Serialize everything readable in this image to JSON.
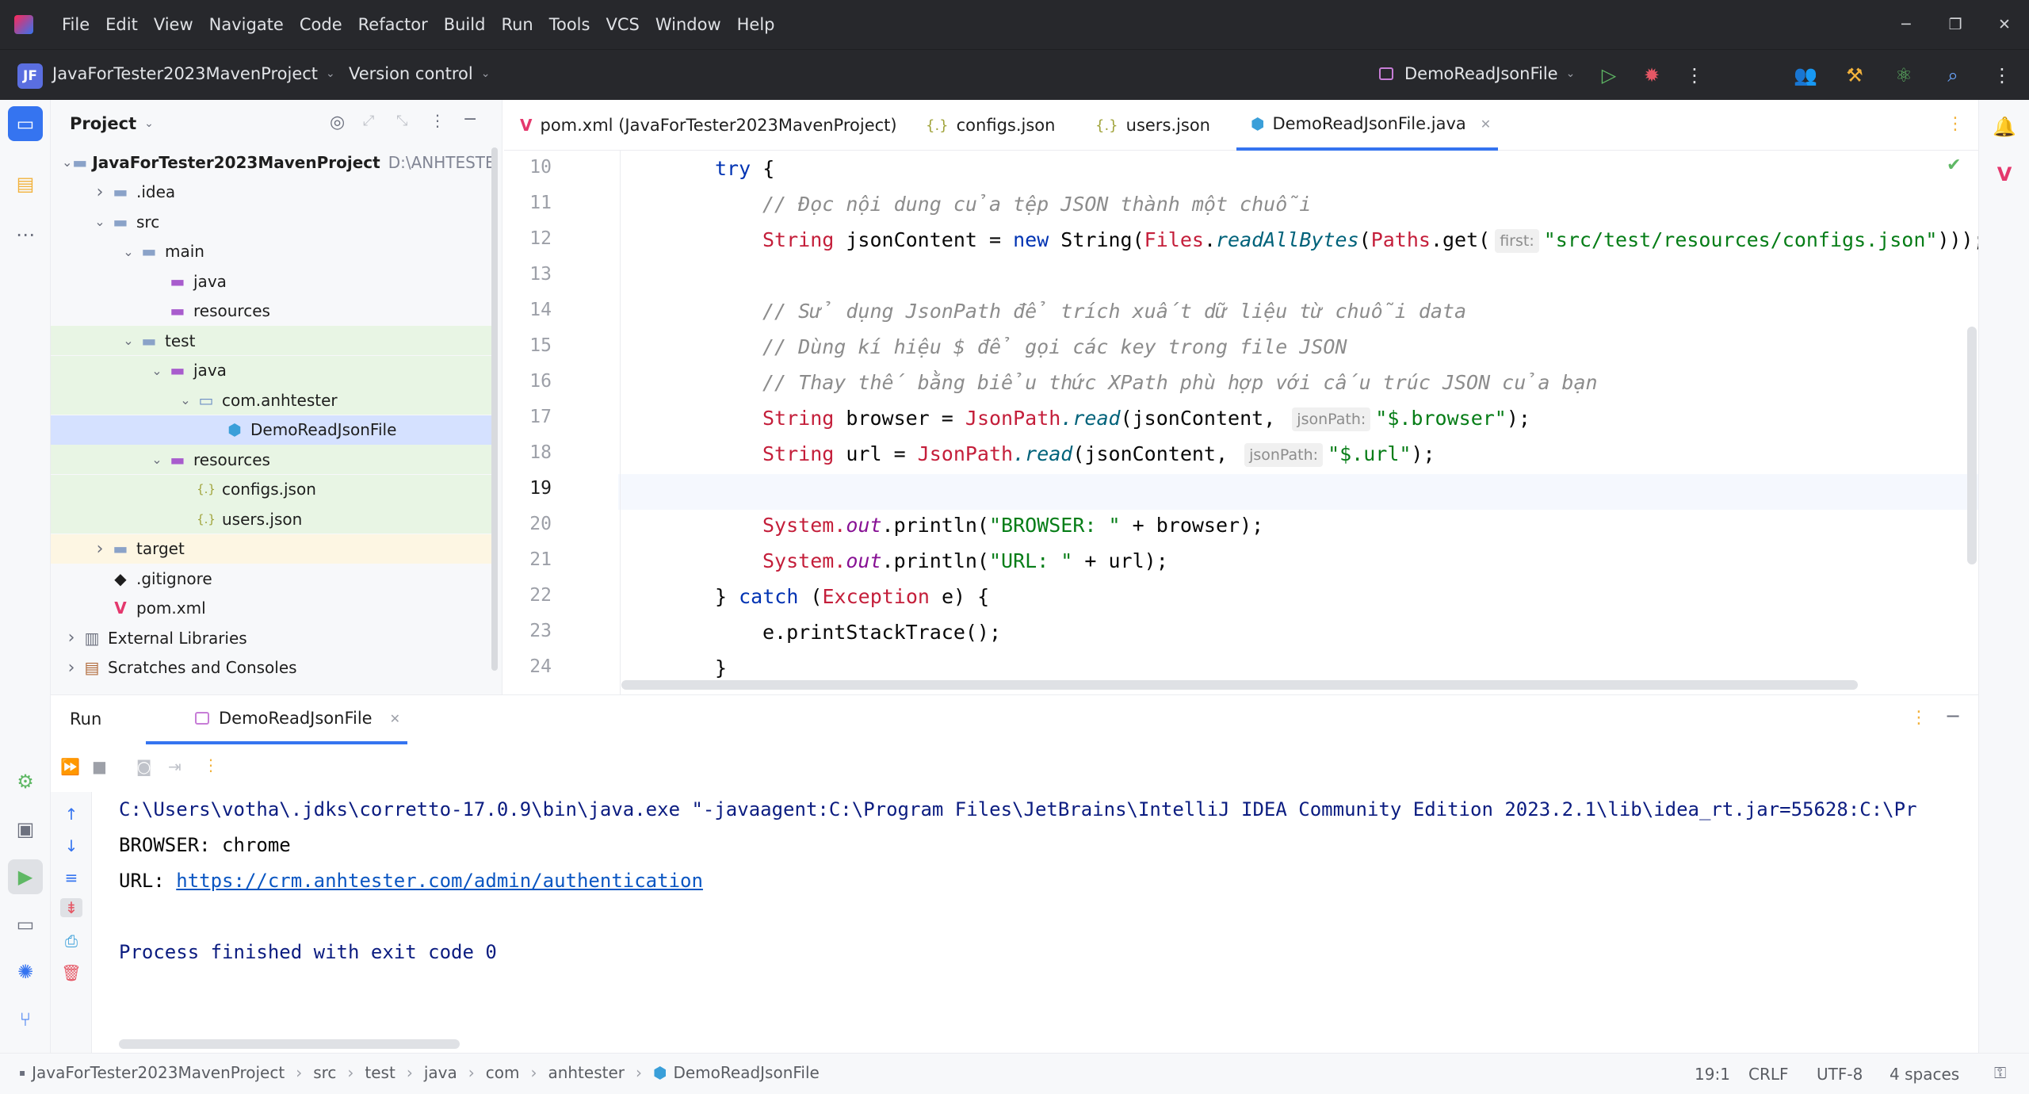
{
  "menu": [
    "File",
    "Edit",
    "View",
    "Navigate",
    "Code",
    "Refactor",
    "Build",
    "Run",
    "Tools",
    "VCS",
    "Window",
    "Help"
  ],
  "toolbar": {
    "project_badge": "JF",
    "project_name": "JavaForTester2023MavenProject",
    "version_control": "Version control",
    "run_config": "DemoReadJsonFile"
  },
  "project_panel": {
    "title": "Project",
    "tree": [
      {
        "label": "JavaForTester2023MavenProject",
        "hint": "D:\\ANHTESTER",
        "depth": 0,
        "expanded": true,
        "icon": "folder-icon",
        "bold": true
      },
      {
        "label": ".idea",
        "depth": 1,
        "expanded": false,
        "icon": "folder-icon"
      },
      {
        "label": "src",
        "depth": 1,
        "expanded": true,
        "icon": "folder-icon"
      },
      {
        "label": "main",
        "depth": 2,
        "expanded": true,
        "icon": "folder-icon"
      },
      {
        "label": "java",
        "depth": 3,
        "icon": "source-folder-icon"
      },
      {
        "label": "resources",
        "depth": 3,
        "icon": "resources-folder-icon"
      },
      {
        "label": "test",
        "depth": 2,
        "expanded": true,
        "icon": "folder-icon"
      },
      {
        "label": "java",
        "depth": 3,
        "expanded": true,
        "icon": "test-folder-icon"
      },
      {
        "label": "com.anhtester",
        "depth": 4,
        "expanded": true,
        "icon": "package-icon"
      },
      {
        "label": "DemoReadJsonFile",
        "depth": 5,
        "icon": "java-class-icon",
        "selected": true
      },
      {
        "label": "resources",
        "depth": 3,
        "expanded": true,
        "icon": "resources-folder-icon"
      },
      {
        "label": "configs.json",
        "depth": 4,
        "icon": "json-icon"
      },
      {
        "label": "users.json",
        "depth": 4,
        "icon": "json-icon"
      },
      {
        "label": "target",
        "depth": 1,
        "expanded": false,
        "icon": "folder-icon"
      },
      {
        "label": ".gitignore",
        "depth": 1,
        "icon": "git-icon"
      },
      {
        "label": "pom.xml",
        "depth": 1,
        "icon": "maven-icon"
      },
      {
        "label": "External Libraries",
        "depth": 0,
        "expanded": false,
        "icon": "library-icon"
      },
      {
        "label": "Scratches and Consoles",
        "depth": 0,
        "expanded": false,
        "icon": "scratches-icon"
      }
    ]
  },
  "editor_tabs": [
    {
      "label": "pom.xml (JavaForTester2023MavenProject)",
      "icon": "maven-icon"
    },
    {
      "label": "configs.json",
      "icon": "json-icon"
    },
    {
      "label": "users.json",
      "icon": "json-icon"
    },
    {
      "label": "DemoReadJsonFile.java",
      "icon": "java-class-icon",
      "active": true
    }
  ],
  "editor": {
    "line_numbers": [
      "10",
      "11",
      "12",
      "13",
      "14",
      "15",
      "16",
      "17",
      "18",
      "19",
      "20",
      "21",
      "22",
      "23",
      "24"
    ],
    "caret_line": "19",
    "code": {
      "l10_try": "try",
      "l10_brace": " {",
      "l11": "// Đọc nội dung của tệp JSON thành một chuỗi",
      "l12_type": "String",
      "l12_a": " jsonContent = ",
      "l12_new": "new",
      "l12_b": " String(",
      "l12_files": "Files",
      "l12_dot": ".",
      "l12_readAll": "readAllBytes",
      "l12_c": "(",
      "l12_paths": "Paths",
      "l12_get": ".get(",
      "l12_hint": "first:",
      "l12_str": "\"src/test/resources/configs.json\"",
      "l12_end": ")));",
      "l14": "// Sử dụng JsonPath để trích xuất dữ liệu từ chuỗi data",
      "l15": "// Dùng kí hiệu $ để gọi các key trong file JSON",
      "l16": "// Thay thế bằng biểu thức XPath phù hợp với cấu trúc JSON của bạn",
      "l17_type": "String",
      "l17_a": " browser = ",
      "l17_jp": "JsonPath",
      "l17_read": ".read",
      "l17_b": "(jsonContent, ",
      "l17_hint": "jsonPath:",
      "l17_str": "\"$.browser\"",
      "l17_end": ");",
      "l18_type": "String",
      "l18_a": " url = ",
      "l18_jp": "JsonPath",
      "l18_read": ".read",
      "l18_b": "(jsonContent, ",
      "l18_hint": "jsonPath:",
      "l18_str": "\"$.url\"",
      "l18_end": ");",
      "l20_sys": "System.",
      "l20_out": "out",
      "l20_a": ".println(",
      "l20_str": "\"BROWSER: \"",
      "l20_end": " + browser);",
      "l21_sys": "System.",
      "l21_out": "out",
      "l21_a": ".println(",
      "l21_str": "\"URL: \"",
      "l21_end": " + url);",
      "l22_a": "} ",
      "l22_catch": "catch",
      "l22_b": " (",
      "l22_exc": "Exception",
      "l22_end": " e) {",
      "l23": "e.printStackTrace();",
      "l24": "}"
    }
  },
  "run_panel": {
    "title": "Run",
    "tab_label": "DemoReadJsonFile",
    "console": {
      "cmd": "C:\\Users\\votha\\.jdks\\corretto-17.0.9\\bin\\java.exe \"-javaagent:C:\\Program Files\\JetBrains\\IntelliJ IDEA Community Edition 2023.2.1\\lib\\idea_rt.jar=55628:C:\\Pr",
      "browser": "BROWSER: chrome",
      "url_prefix": "URL: ",
      "url_link": "https://crm.anhtester.com/admin/authentication",
      "finished": "Process finished with exit code 0"
    }
  },
  "statusbar": {
    "breadcrumb": [
      "JavaForTester2023MavenProject",
      "src",
      "test",
      "java",
      "com",
      "anhtester",
      "DemoReadJsonFile"
    ],
    "position": "19:1",
    "line_sep": "CRLF",
    "encoding": "UTF-8",
    "indent": "4 spaces"
  },
  "colors": {
    "accent": "#3574f0",
    "titlebar": "#27282c",
    "keyword": "#0033b3",
    "string": "#067d17",
    "comment": "#8c8c8c"
  }
}
